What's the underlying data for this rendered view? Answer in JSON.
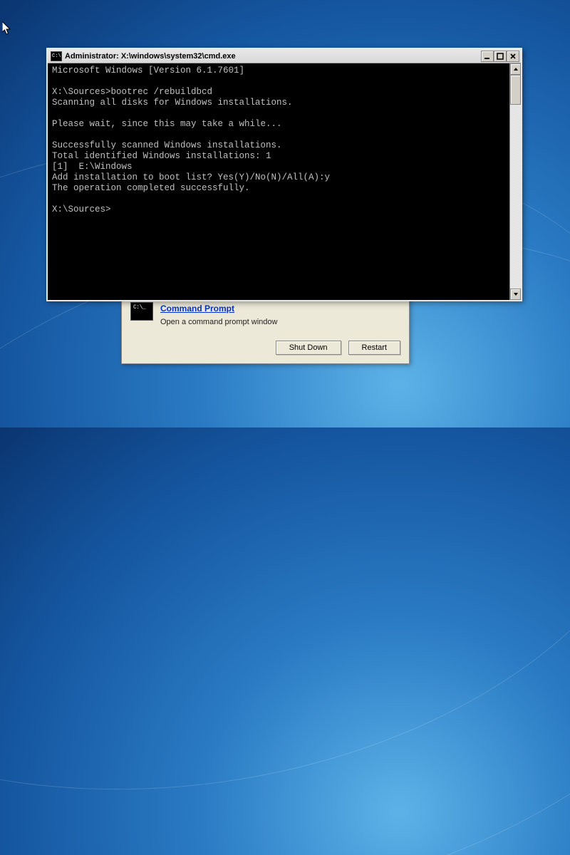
{
  "cmd": {
    "title": "Administrator: X:\\windows\\system32\\cmd.exe",
    "lines": [
      "Microsoft Windows [Version 6.1.7601]",
      "",
      "X:\\Sources>bootrec /rebuildbcd",
      "Scanning all disks for Windows installations.",
      "",
      "Please wait, since this may take a while...",
      "",
      "Successfully scanned Windows installations.",
      "Total identified Windows installations: 1",
      "[1]  E:\\Windows",
      "Add installation to boot list? Yes(Y)/No(N)/All(A):y",
      "The operation completed successfully.",
      "",
      "X:\\Sources>"
    ],
    "icon_text": "C:\\"
  },
  "recovery": {
    "icon_text": "C:\\_",
    "link": "Command Prompt",
    "desc": "Open a command prompt window",
    "shutdown": "Shut Down",
    "restart": "Restart"
  }
}
